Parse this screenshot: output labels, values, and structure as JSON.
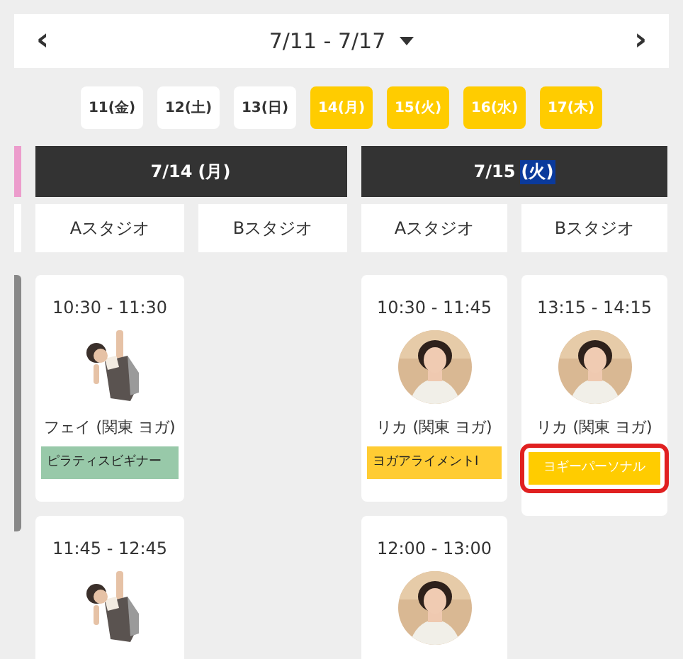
{
  "week_nav": {
    "prev": "‹",
    "range": "7/11 - 7/17",
    "next": "›"
  },
  "day_chips": [
    {
      "label": "11(金)",
      "selected": false
    },
    {
      "label": "12(土)",
      "selected": false
    },
    {
      "label": "13(日)",
      "selected": false
    },
    {
      "label": "14(月)",
      "selected": true
    },
    {
      "label": "15(火)",
      "selected": true
    },
    {
      "label": "16(水)",
      "selected": true
    },
    {
      "label": "17(木)",
      "selected": true
    }
  ],
  "days": [
    {
      "date": "7/14",
      "weekday": "(月)",
      "weekday_selected": false,
      "studios": [
        {
          "name": "Aスタジオ",
          "classes": [
            {
              "time": "10:30 - 11:30",
              "kind": "picture",
              "photo_round": false,
              "instructor": "フェイ (関東 ヨガ)",
              "tag": {
                "label": "ピラティスビギナー",
                "color": "#98c9a9",
                "kind": "regular",
                "highlighted": false
              }
            },
            {
              "time": "11:45 - 12:45",
              "kind": "picture",
              "photo_round": false
            }
          ]
        },
        {
          "name": "Bスタジオ"
        }
      ]
    },
    {
      "date": "7/15",
      "weekday": "(火)",
      "weekday_selected": true,
      "studios": [
        {
          "name": "Aスタジオ",
          "classes": [
            {
              "time": "10:30 - 11:45",
              "kind": "picture",
              "photo_round": true,
              "instructor": "リカ (関東 ヨガ)",
              "tag": {
                "label": "ヨガアライメントI",
                "color": "#ffcc33",
                "kind": "regular",
                "highlighted": false
              }
            },
            {
              "time": "12:00 - 13:00",
              "kind": "picture",
              "photo_round": true
            }
          ]
        },
        {
          "name": "Bスタジオ",
          "classes": [
            {
              "time": "13:15 - 14:15",
              "kind": "picture",
              "photo_round": true,
              "instructor": "リカ (関東 ヨガ)",
              "tag": {
                "label": "ヨギーパーソナル",
                "color": "#ffcc00",
                "kind": "personal",
                "highlighted": true
              }
            }
          ]
        }
      ]
    }
  ]
}
